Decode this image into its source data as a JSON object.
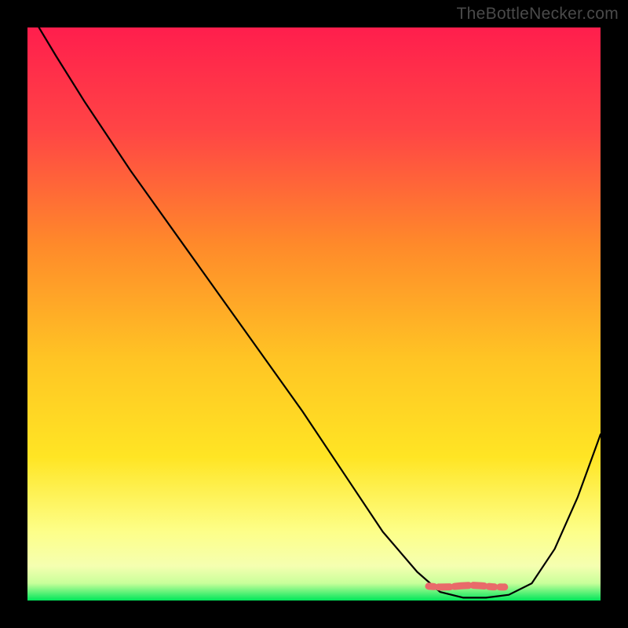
{
  "watermark": "TheBottleNecker.com",
  "chart_data": {
    "type": "line",
    "title": "",
    "xlabel": "",
    "ylabel": "",
    "xlim": [
      0,
      100
    ],
    "ylim": [
      0,
      100
    ],
    "background_gradient": {
      "top": "#ff1e4d",
      "mid1": "#ff8a2a",
      "mid2": "#ffe524",
      "mid3": "#fdff89",
      "bottom": "#00e65a"
    },
    "series": [
      {
        "name": "curve",
        "color": "#000000",
        "points": [
          {
            "x": 2,
            "y": 100
          },
          {
            "x": 5,
            "y": 95
          },
          {
            "x": 10,
            "y": 87
          },
          {
            "x": 18,
            "y": 75
          },
          {
            "x": 28,
            "y": 61
          },
          {
            "x": 38,
            "y": 47
          },
          {
            "x": 48,
            "y": 33
          },
          {
            "x": 56,
            "y": 21
          },
          {
            "x": 62,
            "y": 12
          },
          {
            "x": 68,
            "y": 5
          },
          {
            "x": 72,
            "y": 1.5
          },
          {
            "x": 76,
            "y": 0.5
          },
          {
            "x": 80,
            "y": 0.5
          },
          {
            "x": 84,
            "y": 1
          },
          {
            "x": 88,
            "y": 3
          },
          {
            "x": 92,
            "y": 9
          },
          {
            "x": 96,
            "y": 18
          },
          {
            "x": 100,
            "y": 29
          }
        ]
      },
      {
        "name": "highlight-band",
        "color": "#e96a6a",
        "points": [
          {
            "x": 70,
            "y": 2.5
          },
          {
            "x": 85,
            "y": 2.5
          }
        ]
      }
    ]
  }
}
